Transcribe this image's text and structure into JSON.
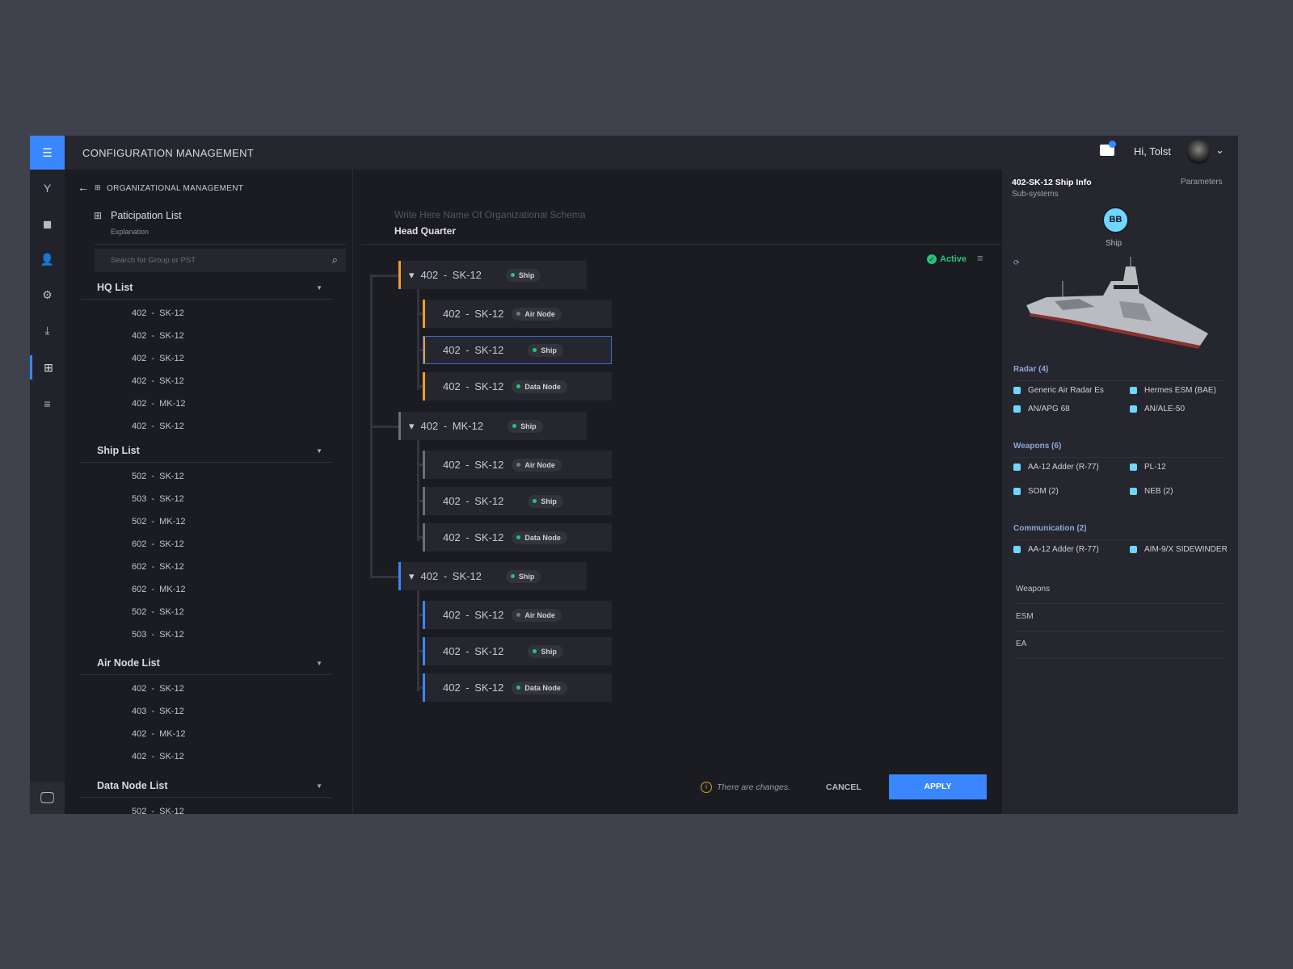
{
  "header": {
    "title": "CONFIGURATION MANAGEMENT",
    "greeting": "Hi, Tolst",
    "mail_icon": "mail-icon",
    "accent": "#3a86ff"
  },
  "sidebar": {
    "items": [
      "menu-icon",
      "branch-icon",
      "cube-icon",
      "user-settings-icon",
      "grid-settings-icon",
      "download-icon",
      "org-chart-icon",
      "list-icon"
    ],
    "bottom": "monitor-icon"
  },
  "breadcrumb": {
    "label": "ORGANIZATIONAL MANAGEMENT"
  },
  "participation": {
    "title": "Paticipation List",
    "subtitle": "Explanation",
    "search_placeholder": "Search for Group or PST",
    "sections": [
      {
        "title": "HQ List",
        "items": [
          "402  -  SK-12",
          "402  -  SK-12",
          "402  -  SK-12",
          "402  -  SK-12",
          "402  -  MK-12",
          "402  -  SK-12"
        ]
      },
      {
        "title": "Ship List",
        "items": [
          "502  -  SK-12",
          "503  -  SK-12",
          "502  -  MK-12",
          "602  -  SK-12",
          "602  -  SK-12",
          "602  -  MK-12",
          "502  -  SK-12",
          "503  -  SK-12"
        ]
      },
      {
        "title": "Air Node List",
        "items": [
          "402  -  SK-12",
          "403  -  SK-12",
          "402  -  MK-12",
          "402  -  SK-12"
        ]
      },
      {
        "title": "Data Node List",
        "items": [
          "502  -  SK-12"
        ]
      }
    ]
  },
  "schema": {
    "name_placeholder": "Write Here Name Of Organizational Schema",
    "name": "Head Quarter",
    "status": "Active",
    "status_color": "#27c27a"
  },
  "tree": [
    {
      "label": "402  -  SK-12",
      "type": "Ship",
      "color": "#f29a2e",
      "children": [
        {
          "label": "402  -  SK-12",
          "type": "Air Node"
        },
        {
          "label": "402  -  SK-12",
          "type": "Ship",
          "selected": true
        },
        {
          "label": "402  -  SK-12",
          "type": "Data Node"
        }
      ]
    },
    {
      "label": "402  -  MK-12",
      "type": "Ship",
      "color": "#6b6d78",
      "children": [
        {
          "label": "402  -  SK-12",
          "type": "Air Node"
        },
        {
          "label": "402  -  SK-12",
          "type": "Ship"
        },
        {
          "label": "402  -  SK-12",
          "type": "Data Node"
        }
      ]
    },
    {
      "label": "402  -  SK-12",
      "type": "Ship",
      "color": "#3a86ff",
      "children": [
        {
          "label": "402  -  SK-12",
          "type": "Air Node"
        },
        {
          "label": "402  -  SK-12",
          "type": "Ship"
        },
        {
          "label": "402  -  SK-12",
          "type": "Data Node"
        }
      ]
    }
  ],
  "footer": {
    "notice": "There are  changes.",
    "cancel": "CANCEL",
    "apply": "APPLY"
  },
  "info": {
    "title": "402-SK-12 Ship Info",
    "subtitle": "Sub-systems",
    "tab": "Parameters",
    "avatar": "BB",
    "avatar_label": "Ship",
    "categories": [
      {
        "title": "Radar (4)",
        "items": [
          "Generic Air Radar Es",
          "Hermes ESM (BAE)",
          "AN/APG 68",
          "AN/ALE-50"
        ]
      },
      {
        "title": "Weapons (6)",
        "items": [
          "AA-12 Adder (R-77)",
          "PL-12",
          "SOM (2)",
          "NEB (2)"
        ]
      },
      {
        "title": "Communication (2)",
        "items": [
          "AA-12 Adder (R-77)",
          "AIM-9/X SIDEWINDER"
        ]
      }
    ],
    "plain": [
      "Weapons",
      "ESM",
      "EA"
    ]
  }
}
